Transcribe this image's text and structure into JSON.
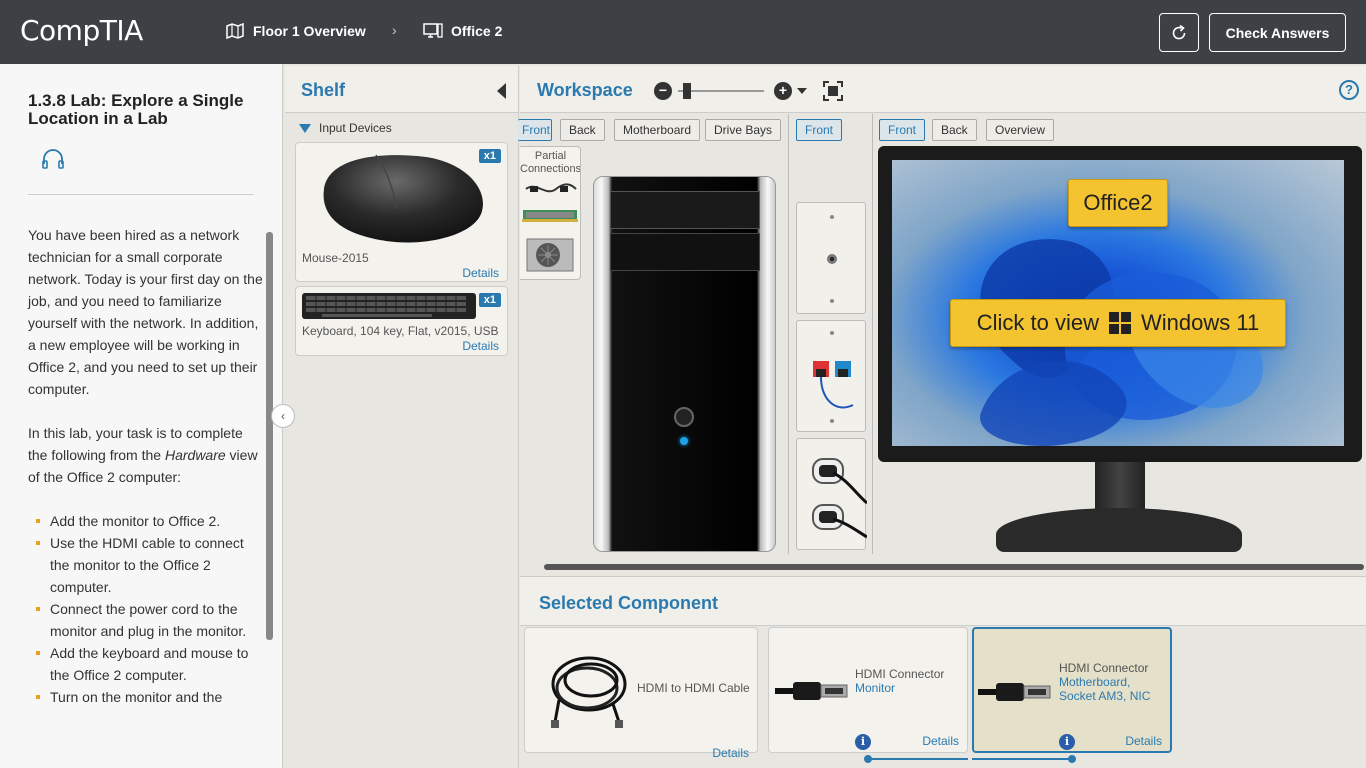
{
  "header": {
    "logo": "CompTIA",
    "breadcrumb_1": "Floor 1 Overview",
    "breadcrumb_2": "Office 2",
    "check_answers": "Check Answers"
  },
  "instructions": {
    "title": "1.3.8 Lab: Explore a Single Location in a Lab",
    "para1": "You have been hired as a network technician for a small corporate network. Today is your first day on the job, and you need to familiarize yourself with the network. In addition, a new employee will be working in Office 2, and you need to set up their computer.",
    "para2_pre": "In this lab, your task is to complete the following from the ",
    "para2_em": "Hardware",
    "para2_post": " view of the Office 2 computer:",
    "tasks": [
      "Add the monitor to Office 2.",
      "Use the HDMI cable to connect the monitor to the Office 2 computer.",
      "Connect the power cord to the monitor and plug in the monitor.",
      "Add the keyboard and mouse to the Office 2 computer.",
      "Turn on the monitor and the"
    ]
  },
  "shelf": {
    "title": "Shelf",
    "category": "Input Devices",
    "items": [
      {
        "label": "Mouse-2015",
        "count": "x1",
        "details": "Details"
      },
      {
        "label": "Keyboard, 104 key, Flat, v2015, USB",
        "count": "x1",
        "details": "Details"
      }
    ]
  },
  "workspace": {
    "title": "Workspace",
    "computer_tabs": [
      "Front",
      "Back",
      "Motherboard",
      "Drive Bays"
    ],
    "wall_tabs": [
      "Front"
    ],
    "monitor_tabs": [
      "Front",
      "Back",
      "Overview"
    ],
    "partial_label": "Partial Connections",
    "office_badge": "Office2",
    "click_view_pre": "Click to view",
    "click_view_post": "Windows 11"
  },
  "selected": {
    "title": "Selected Component",
    "cards": [
      {
        "name": "HDMI to HDMI Cable",
        "sub": "",
        "details": "Details"
      },
      {
        "name": "HDMI Connector",
        "sub": "Monitor",
        "details": "Details"
      },
      {
        "name": "HDMI Connector",
        "sub": "Motherboard, Socket AM3, NIC",
        "details": "Details"
      }
    ]
  },
  "colors": {
    "accent": "#2a7ab0",
    "topbar": "#3d4146",
    "badge_yellow": "#f4c430"
  }
}
